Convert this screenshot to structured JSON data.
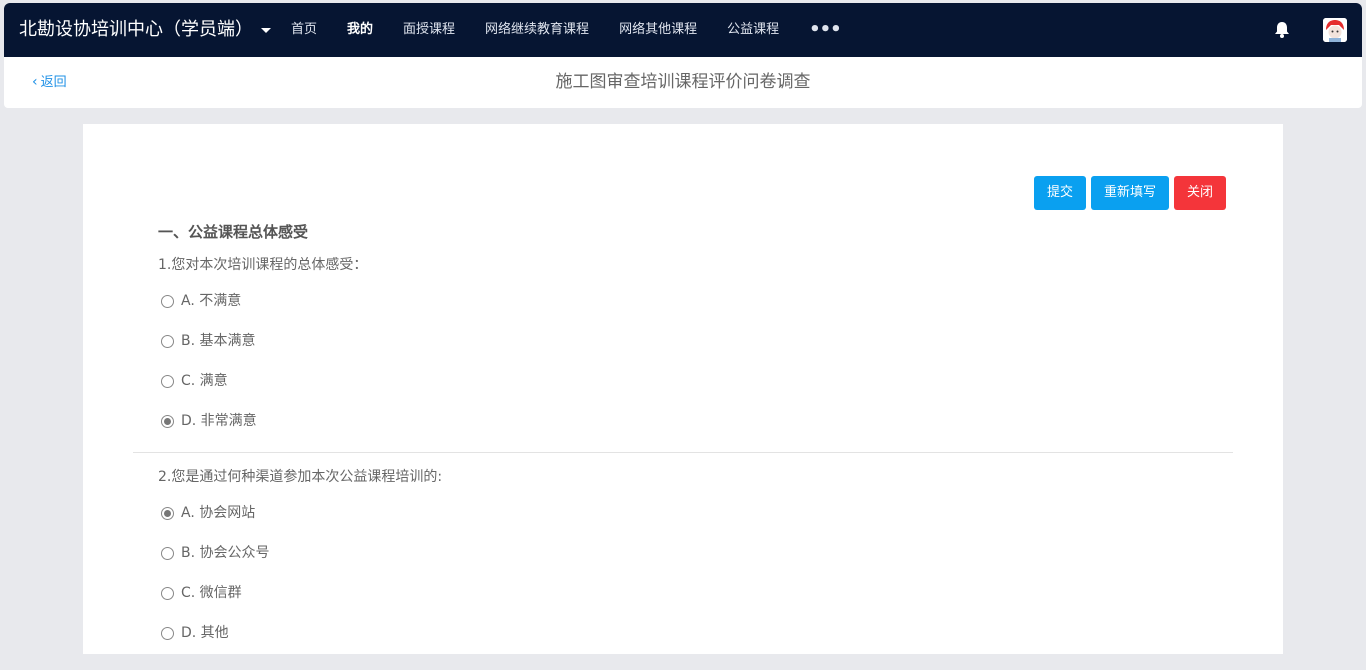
{
  "header": {
    "brand": "北勘设协培训中心（学员端）",
    "nav": [
      {
        "label": "首页",
        "active": false
      },
      {
        "label": "我的",
        "active": true
      },
      {
        "label": "面授课程",
        "active": false
      },
      {
        "label": "网络继续教育课程",
        "active": false
      },
      {
        "label": "网络其他课程",
        "active": false
      },
      {
        "label": "公益课程",
        "active": false
      }
    ],
    "more_icon": "more-dots-icon",
    "bell_icon": "bell-icon",
    "avatar_icon": "user-avatar"
  },
  "subheader": {
    "back_label": "返回",
    "title": "施工图审查培训课程评价问卷调查"
  },
  "actions": {
    "submit": "提交",
    "reset": "重新填写",
    "close": "关闭"
  },
  "survey": {
    "section_title": "一、公益课程总体感受",
    "questions": [
      {
        "text": "1.您对本次培训课程的总体感受：",
        "options": [
          {
            "label": "A. 不满意",
            "checked": false
          },
          {
            "label": "B. 基本满意",
            "checked": false
          },
          {
            "label": "C. 满意",
            "checked": false
          },
          {
            "label": "D. 非常满意",
            "checked": true
          }
        ]
      },
      {
        "text": "2.您是通过何种渠道参加本次公益课程培训的:",
        "options": [
          {
            "label": "A. 协会网站",
            "checked": true
          },
          {
            "label": "B. 协会公众号",
            "checked": false
          },
          {
            "label": "C. 微信群",
            "checked": false
          },
          {
            "label": "D. 其他",
            "checked": false
          }
        ]
      }
    ]
  },
  "colors": {
    "topbar": "#061532",
    "primary_button": "#0aa0f0",
    "danger_button": "#f4353a",
    "link": "#1e90e6"
  }
}
